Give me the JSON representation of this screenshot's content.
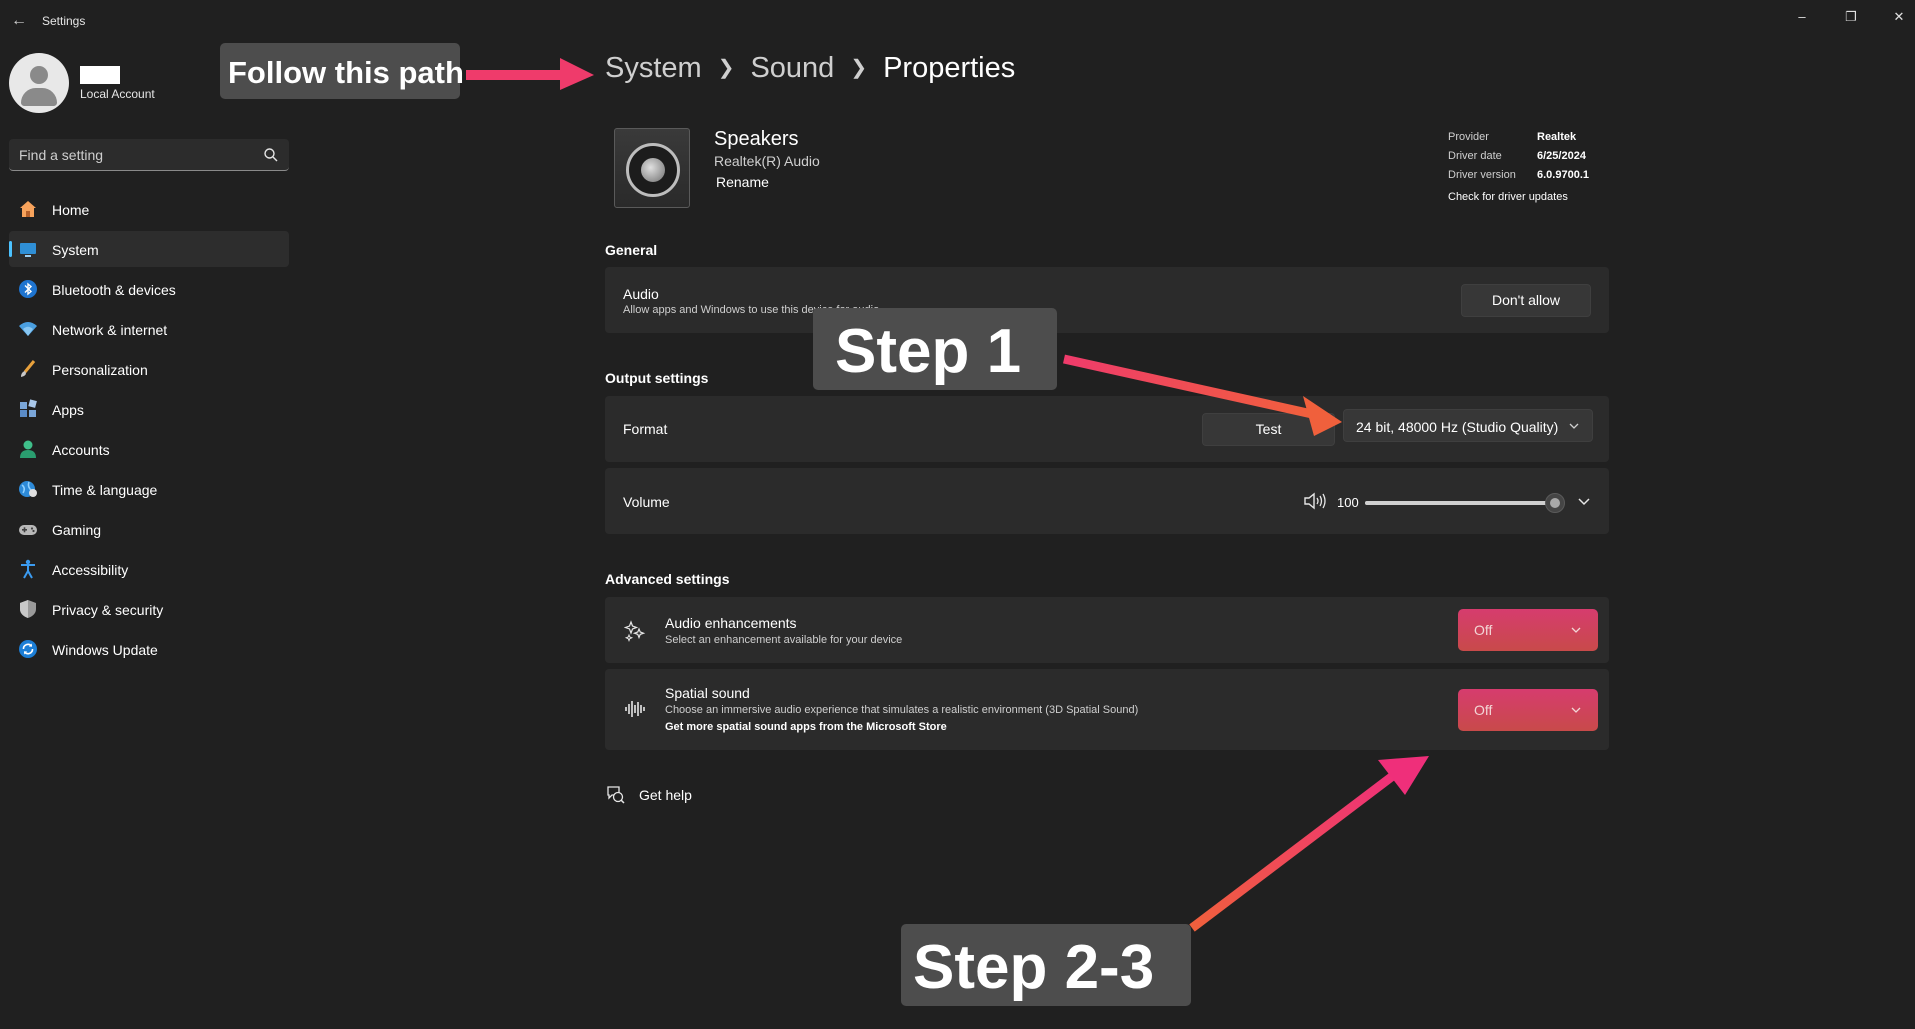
{
  "app": {
    "title": "Settings"
  },
  "user": {
    "account_type": "Local Account"
  },
  "search": {
    "placeholder": "Find a setting"
  },
  "sidebar": {
    "items": [
      {
        "label": "Home",
        "icon": "home-icon"
      },
      {
        "label": "System",
        "icon": "system-icon",
        "active": true
      },
      {
        "label": "Bluetooth & devices",
        "icon": "bluetooth-icon"
      },
      {
        "label": "Network & internet",
        "icon": "wifi-icon"
      },
      {
        "label": "Personalization",
        "icon": "brush-icon"
      },
      {
        "label": "Apps",
        "icon": "apps-icon"
      },
      {
        "label": "Accounts",
        "icon": "accounts-icon"
      },
      {
        "label": "Time & language",
        "icon": "globe-icon"
      },
      {
        "label": "Gaming",
        "icon": "gamepad-icon"
      },
      {
        "label": "Accessibility",
        "icon": "accessibility-icon"
      },
      {
        "label": "Privacy & security",
        "icon": "shield-icon"
      },
      {
        "label": "Windows Update",
        "icon": "update-icon"
      }
    ]
  },
  "annotations": {
    "path_callout": "Follow this path",
    "step1": "Step 1",
    "step23": "Step 2-3",
    "arrow_color": "#ef3b6b"
  },
  "breadcrumb": [
    "System",
    "Sound",
    "Properties"
  ],
  "device": {
    "name": "Speakers",
    "subtitle": "Realtek(R) Audio",
    "rename_label": "Rename"
  },
  "driver": {
    "rows": [
      {
        "key": "Provider",
        "value": "Realtek"
      },
      {
        "key": "Driver date",
        "value": "6/25/2024"
      },
      {
        "key": "Driver version",
        "value": "6.0.9700.1"
      }
    ],
    "update_link": "Check for driver updates"
  },
  "general": {
    "heading": "General",
    "audio": {
      "title": "Audio",
      "description": "Allow apps and Windows to use this device for audio",
      "button": "Don't allow"
    }
  },
  "output": {
    "heading": "Output settings",
    "format": {
      "label": "Format",
      "test_button": "Test",
      "selected": "24 bit, 48000 Hz (Studio Quality)"
    },
    "volume": {
      "label": "Volume",
      "value": "100",
      "level": 100
    }
  },
  "advanced": {
    "heading": "Advanced settings",
    "enhancements": {
      "title": "Audio enhancements",
      "description": "Select an enhancement available for your device",
      "value": "Off"
    },
    "spatial": {
      "title": "Spatial sound",
      "description": "Choose an immersive audio experience that simulates a realistic environment (3D Spatial Sound)",
      "link": "Get more spatial sound apps from the Microsoft Store",
      "value": "Off"
    }
  },
  "help": {
    "label": "Get help"
  },
  "colors": {
    "accent": "#4cc2ff",
    "background": "#202020",
    "card": "#2b2b2b",
    "off_start": "#d63c6e",
    "off_end": "#c84a4a"
  }
}
